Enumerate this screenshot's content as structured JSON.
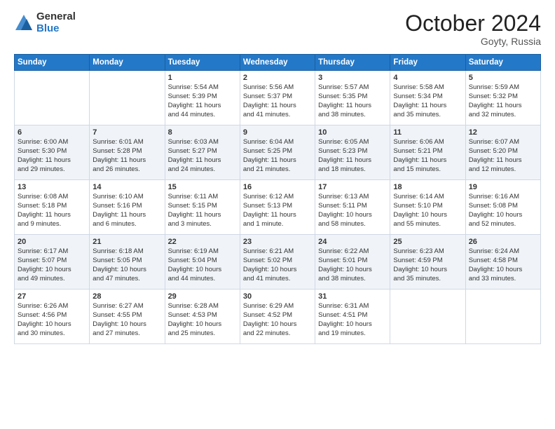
{
  "header": {
    "logo_general": "General",
    "logo_blue": "Blue",
    "month": "October 2024",
    "location": "Goyty, Russia"
  },
  "days_of_week": [
    "Sunday",
    "Monday",
    "Tuesday",
    "Wednesday",
    "Thursday",
    "Friday",
    "Saturday"
  ],
  "weeks": [
    [
      {
        "day": "",
        "sunrise": "",
        "sunset": "",
        "daylight": ""
      },
      {
        "day": "",
        "sunrise": "",
        "sunset": "",
        "daylight": ""
      },
      {
        "day": "1",
        "sunrise": "Sunrise: 5:54 AM",
        "sunset": "Sunset: 5:39 PM",
        "daylight": "Daylight: 11 hours and 44 minutes."
      },
      {
        "day": "2",
        "sunrise": "Sunrise: 5:56 AM",
        "sunset": "Sunset: 5:37 PM",
        "daylight": "Daylight: 11 hours and 41 minutes."
      },
      {
        "day": "3",
        "sunrise": "Sunrise: 5:57 AM",
        "sunset": "Sunset: 5:35 PM",
        "daylight": "Daylight: 11 hours and 38 minutes."
      },
      {
        "day": "4",
        "sunrise": "Sunrise: 5:58 AM",
        "sunset": "Sunset: 5:34 PM",
        "daylight": "Daylight: 11 hours and 35 minutes."
      },
      {
        "day": "5",
        "sunrise": "Sunrise: 5:59 AM",
        "sunset": "Sunset: 5:32 PM",
        "daylight": "Daylight: 11 hours and 32 minutes."
      }
    ],
    [
      {
        "day": "6",
        "sunrise": "Sunrise: 6:00 AM",
        "sunset": "Sunset: 5:30 PM",
        "daylight": "Daylight: 11 hours and 29 minutes."
      },
      {
        "day": "7",
        "sunrise": "Sunrise: 6:01 AM",
        "sunset": "Sunset: 5:28 PM",
        "daylight": "Daylight: 11 hours and 26 minutes."
      },
      {
        "day": "8",
        "sunrise": "Sunrise: 6:03 AM",
        "sunset": "Sunset: 5:27 PM",
        "daylight": "Daylight: 11 hours and 24 minutes."
      },
      {
        "day": "9",
        "sunrise": "Sunrise: 6:04 AM",
        "sunset": "Sunset: 5:25 PM",
        "daylight": "Daylight: 11 hours and 21 minutes."
      },
      {
        "day": "10",
        "sunrise": "Sunrise: 6:05 AM",
        "sunset": "Sunset: 5:23 PM",
        "daylight": "Daylight: 11 hours and 18 minutes."
      },
      {
        "day": "11",
        "sunrise": "Sunrise: 6:06 AM",
        "sunset": "Sunset: 5:21 PM",
        "daylight": "Daylight: 11 hours and 15 minutes."
      },
      {
        "day": "12",
        "sunrise": "Sunrise: 6:07 AM",
        "sunset": "Sunset: 5:20 PM",
        "daylight": "Daylight: 11 hours and 12 minutes."
      }
    ],
    [
      {
        "day": "13",
        "sunrise": "Sunrise: 6:08 AM",
        "sunset": "Sunset: 5:18 PM",
        "daylight": "Daylight: 11 hours and 9 minutes."
      },
      {
        "day": "14",
        "sunrise": "Sunrise: 6:10 AM",
        "sunset": "Sunset: 5:16 PM",
        "daylight": "Daylight: 11 hours and 6 minutes."
      },
      {
        "day": "15",
        "sunrise": "Sunrise: 6:11 AM",
        "sunset": "Sunset: 5:15 PM",
        "daylight": "Daylight: 11 hours and 3 minutes."
      },
      {
        "day": "16",
        "sunrise": "Sunrise: 6:12 AM",
        "sunset": "Sunset: 5:13 PM",
        "daylight": "Daylight: 11 hours and 1 minute."
      },
      {
        "day": "17",
        "sunrise": "Sunrise: 6:13 AM",
        "sunset": "Sunset: 5:11 PM",
        "daylight": "Daylight: 10 hours and 58 minutes."
      },
      {
        "day": "18",
        "sunrise": "Sunrise: 6:14 AM",
        "sunset": "Sunset: 5:10 PM",
        "daylight": "Daylight: 10 hours and 55 minutes."
      },
      {
        "day": "19",
        "sunrise": "Sunrise: 6:16 AM",
        "sunset": "Sunset: 5:08 PM",
        "daylight": "Daylight: 10 hours and 52 minutes."
      }
    ],
    [
      {
        "day": "20",
        "sunrise": "Sunrise: 6:17 AM",
        "sunset": "Sunset: 5:07 PM",
        "daylight": "Daylight: 10 hours and 49 minutes."
      },
      {
        "day": "21",
        "sunrise": "Sunrise: 6:18 AM",
        "sunset": "Sunset: 5:05 PM",
        "daylight": "Daylight: 10 hours and 47 minutes."
      },
      {
        "day": "22",
        "sunrise": "Sunrise: 6:19 AM",
        "sunset": "Sunset: 5:04 PM",
        "daylight": "Daylight: 10 hours and 44 minutes."
      },
      {
        "day": "23",
        "sunrise": "Sunrise: 6:21 AM",
        "sunset": "Sunset: 5:02 PM",
        "daylight": "Daylight: 10 hours and 41 minutes."
      },
      {
        "day": "24",
        "sunrise": "Sunrise: 6:22 AM",
        "sunset": "Sunset: 5:01 PM",
        "daylight": "Daylight: 10 hours and 38 minutes."
      },
      {
        "day": "25",
        "sunrise": "Sunrise: 6:23 AM",
        "sunset": "Sunset: 4:59 PM",
        "daylight": "Daylight: 10 hours and 35 minutes."
      },
      {
        "day": "26",
        "sunrise": "Sunrise: 6:24 AM",
        "sunset": "Sunset: 4:58 PM",
        "daylight": "Daylight: 10 hours and 33 minutes."
      }
    ],
    [
      {
        "day": "27",
        "sunrise": "Sunrise: 6:26 AM",
        "sunset": "Sunset: 4:56 PM",
        "daylight": "Daylight: 10 hours and 30 minutes."
      },
      {
        "day": "28",
        "sunrise": "Sunrise: 6:27 AM",
        "sunset": "Sunset: 4:55 PM",
        "daylight": "Daylight: 10 hours and 27 minutes."
      },
      {
        "day": "29",
        "sunrise": "Sunrise: 6:28 AM",
        "sunset": "Sunset: 4:53 PM",
        "daylight": "Daylight: 10 hours and 25 minutes."
      },
      {
        "day": "30",
        "sunrise": "Sunrise: 6:29 AM",
        "sunset": "Sunset: 4:52 PM",
        "daylight": "Daylight: 10 hours and 22 minutes."
      },
      {
        "day": "31",
        "sunrise": "Sunrise: 6:31 AM",
        "sunset": "Sunset: 4:51 PM",
        "daylight": "Daylight: 10 hours and 19 minutes."
      },
      {
        "day": "",
        "sunrise": "",
        "sunset": "",
        "daylight": ""
      },
      {
        "day": "",
        "sunrise": "",
        "sunset": "",
        "daylight": ""
      }
    ]
  ]
}
